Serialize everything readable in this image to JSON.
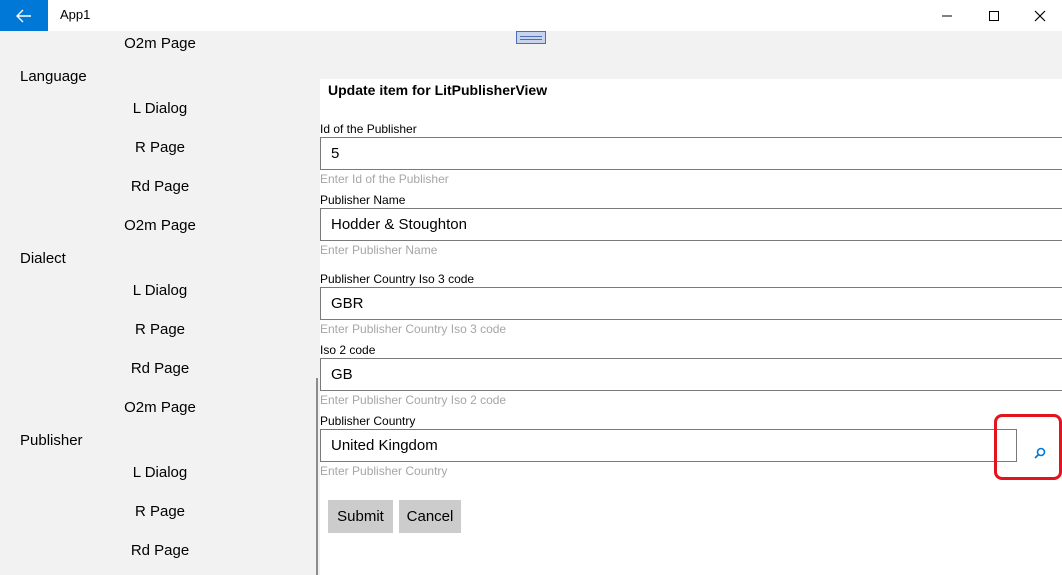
{
  "window": {
    "title": "App1",
    "back_glyph": "←",
    "minimize_glyph": "—",
    "maximize_glyph": "☐",
    "close_glyph": "✕"
  },
  "sidebar": {
    "top_item": "O2m Page",
    "groups": [
      {
        "label": "Language",
        "items": [
          "L Dialog",
          "R Page",
          "Rd Page",
          "O2m Page"
        ]
      },
      {
        "label": "Dialect",
        "items": [
          "L Dialog",
          "R Page",
          "Rd Page",
          "O2m Page"
        ]
      },
      {
        "label": "Publisher",
        "items": [
          "L Dialog",
          "R Page",
          "Rd Page"
        ]
      }
    ]
  },
  "form": {
    "title": "Update item for LitPublisherView",
    "fields": [
      {
        "label": "Id of the Publisher",
        "value": "5",
        "hint": "Enter Id of the Publisher"
      },
      {
        "label": "Publisher Name",
        "value": "Hodder & Stoughton",
        "hint": "Enter Publisher Name"
      },
      {
        "label": "Publisher Country Iso 3 code",
        "value": "GBR",
        "hint": "Enter Publisher Country Iso 3 code"
      },
      {
        "label": "Iso 2 code",
        "value": "GB",
        "hint": "Enter Publisher Country Iso 2 code"
      },
      {
        "label": "Publisher Country",
        "value": "United Kingdom",
        "hint": "Enter Publisher Country"
      }
    ],
    "search_icon": "search-icon",
    "submit_label": "Submit",
    "cancel_label": "Cancel"
  },
  "colors": {
    "accent": "#0078d7",
    "highlight": "#e3141e",
    "button_bg": "#cccccc"
  }
}
